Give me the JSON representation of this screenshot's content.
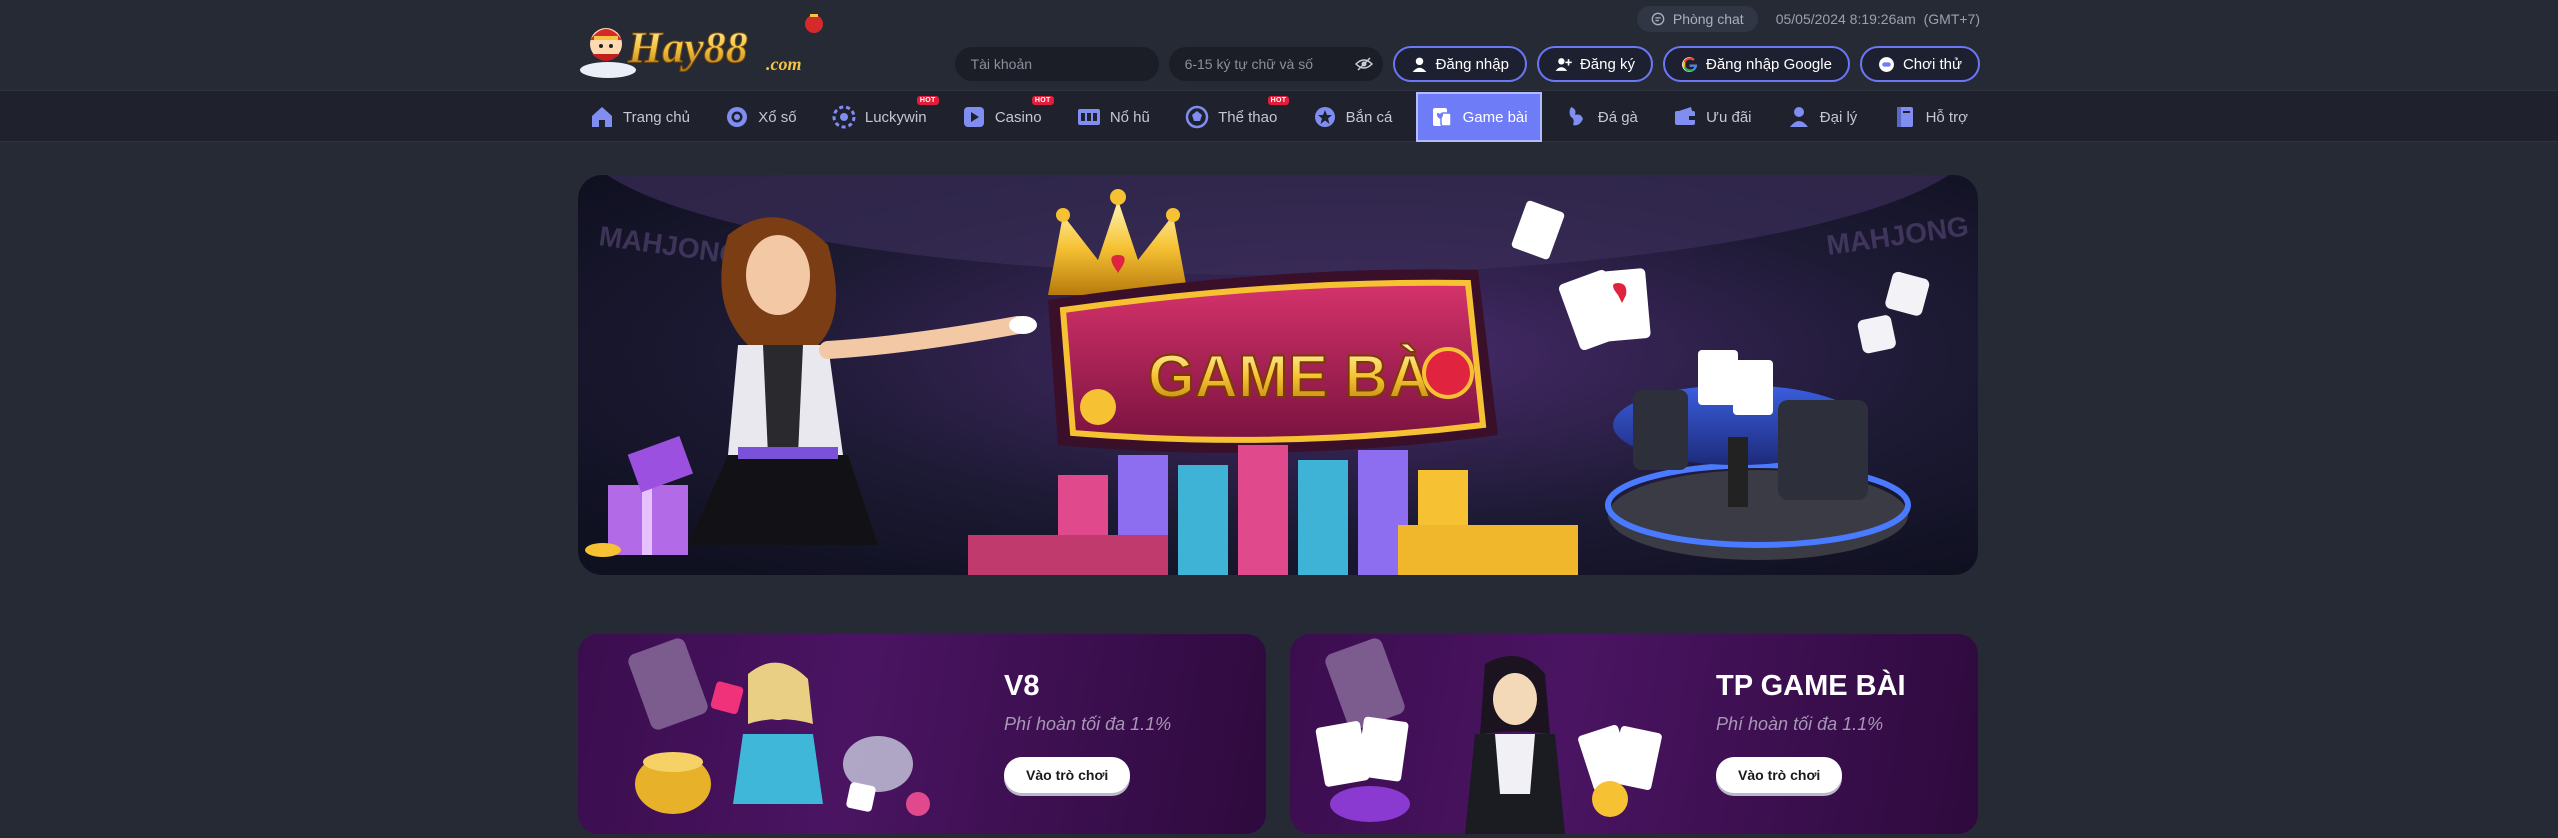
{
  "brand": {
    "logo_text": "Hay88",
    "logo_domain": ".com"
  },
  "topbar": {
    "chat_label": "Phòng chat",
    "datetime": "05/05/2024 8:19:26am",
    "timezone": "(GMT+7)"
  },
  "auth": {
    "username_placeholder": "Tài khoản",
    "password_placeholder": "6-15 ký tự chữ và số",
    "login_label": "Đăng nhập",
    "register_label": "Đăng ký",
    "google_label": "Đăng nhập Google",
    "trial_label": "Chơi thử"
  },
  "nav": {
    "items": [
      {
        "label": "Trang chủ",
        "icon": "home-icon",
        "hot": false
      },
      {
        "label": "Xổ số",
        "icon": "lottery-icon",
        "hot": false
      },
      {
        "label": "Luckywin",
        "icon": "luckywin-icon",
        "hot": true
      },
      {
        "label": "Casino",
        "icon": "casino-icon",
        "hot": true
      },
      {
        "label": "Nổ hũ",
        "icon": "slots-icon",
        "hot": false
      },
      {
        "label": "Thể thao",
        "icon": "sports-icon",
        "hot": true
      },
      {
        "label": "Bắn cá",
        "icon": "fishing-icon",
        "hot": false
      },
      {
        "label": "Game bài",
        "icon": "cards-icon",
        "hot": false,
        "active": true
      },
      {
        "label": "Đá gà",
        "icon": "cockfight-icon",
        "hot": false
      },
      {
        "label": "Ưu đãi",
        "icon": "promo-icon",
        "hot": false
      },
      {
        "label": "Đại lý",
        "icon": "agent-icon",
        "hot": false
      },
      {
        "label": "Hỗ trợ",
        "icon": "support-icon",
        "hot": false
      }
    ],
    "hot_badge": "HOT"
  },
  "banner": {
    "title": "GAME BÀI",
    "backdrop_text": "MAHJONG"
  },
  "games": [
    {
      "title": "V8",
      "rebate": "Phí hoàn tối đa 1.1%",
      "button": "Vào trò chơi"
    },
    {
      "title": "TP GAME BÀI",
      "rebate": "Phí hoàn tối đa 1.1%",
      "button": "Vào trò chơi"
    }
  ],
  "colors": {
    "background": "#262a35",
    "nav_background": "#1f222c",
    "accent": "#6f7cf7",
    "card_purple": "#4a1462",
    "hot_red": "#e21d3c"
  }
}
